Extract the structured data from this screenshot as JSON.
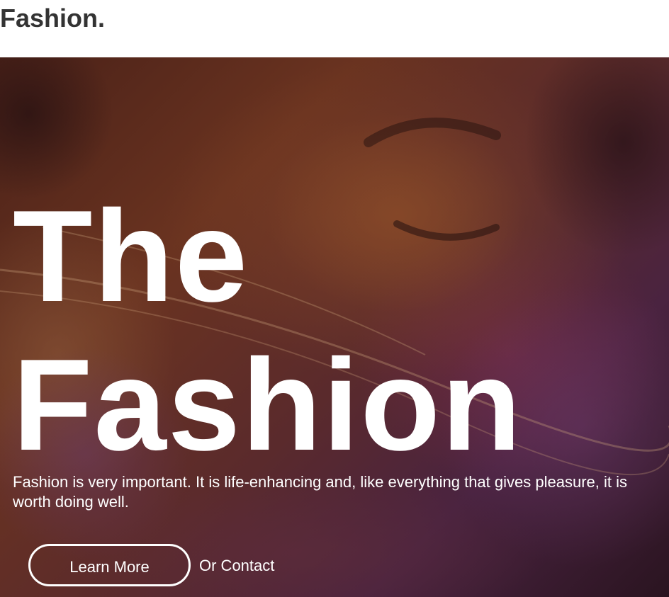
{
  "header": {
    "brand": "Fashion."
  },
  "hero": {
    "title_line1": "The",
    "title_line2": "Fashion",
    "description": "Fashion is very important. It is life-enhancing and, like everything that gives pleasure, it is worth doing well.",
    "learn_more_label": "Learn More",
    "contact_label": "Or Contact"
  },
  "colors": {
    "brand_text": "#333333",
    "hero_text": "#ffffff"
  }
}
